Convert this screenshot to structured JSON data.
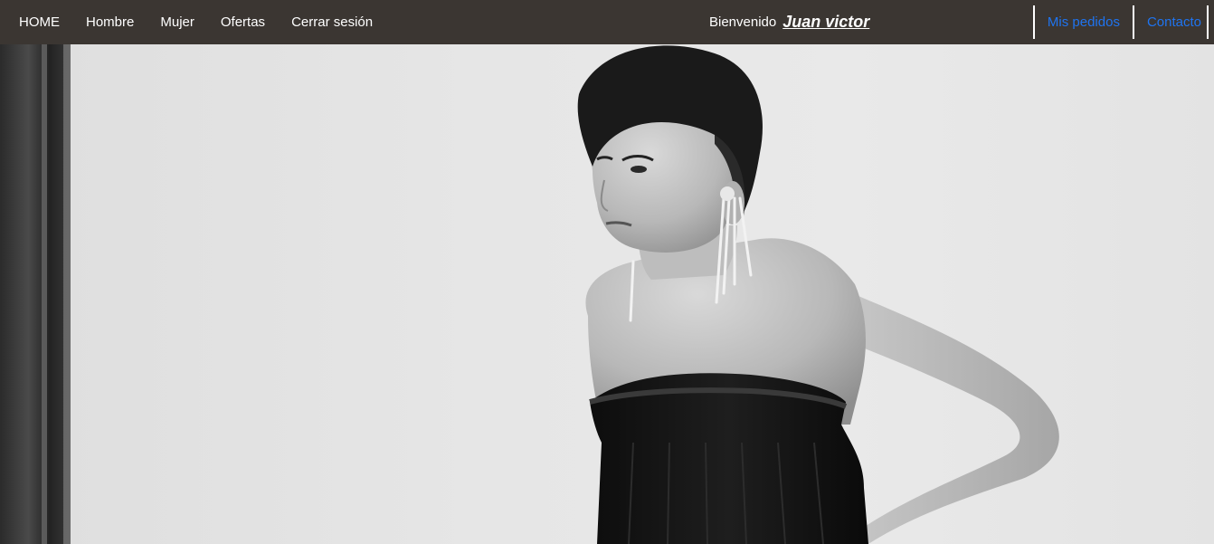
{
  "navbar": {
    "links": [
      {
        "label": "HOME"
      },
      {
        "label": "Hombre"
      },
      {
        "label": "Mujer"
      },
      {
        "label": "Ofertas"
      },
      {
        "label": "Cerrar sesión"
      }
    ],
    "welcome_text": "Bienvenido",
    "username": "Juan victor",
    "right_links": [
      {
        "label": "Mis pedidos"
      },
      {
        "label": "Contacto"
      }
    ],
    "colors": {
      "background": "#3b3632",
      "text": "#ffffff",
      "accent_link": "#1f74f0"
    }
  },
  "hero": {
    "image": "fashion-model-photo",
    "style": "black-and-white"
  }
}
